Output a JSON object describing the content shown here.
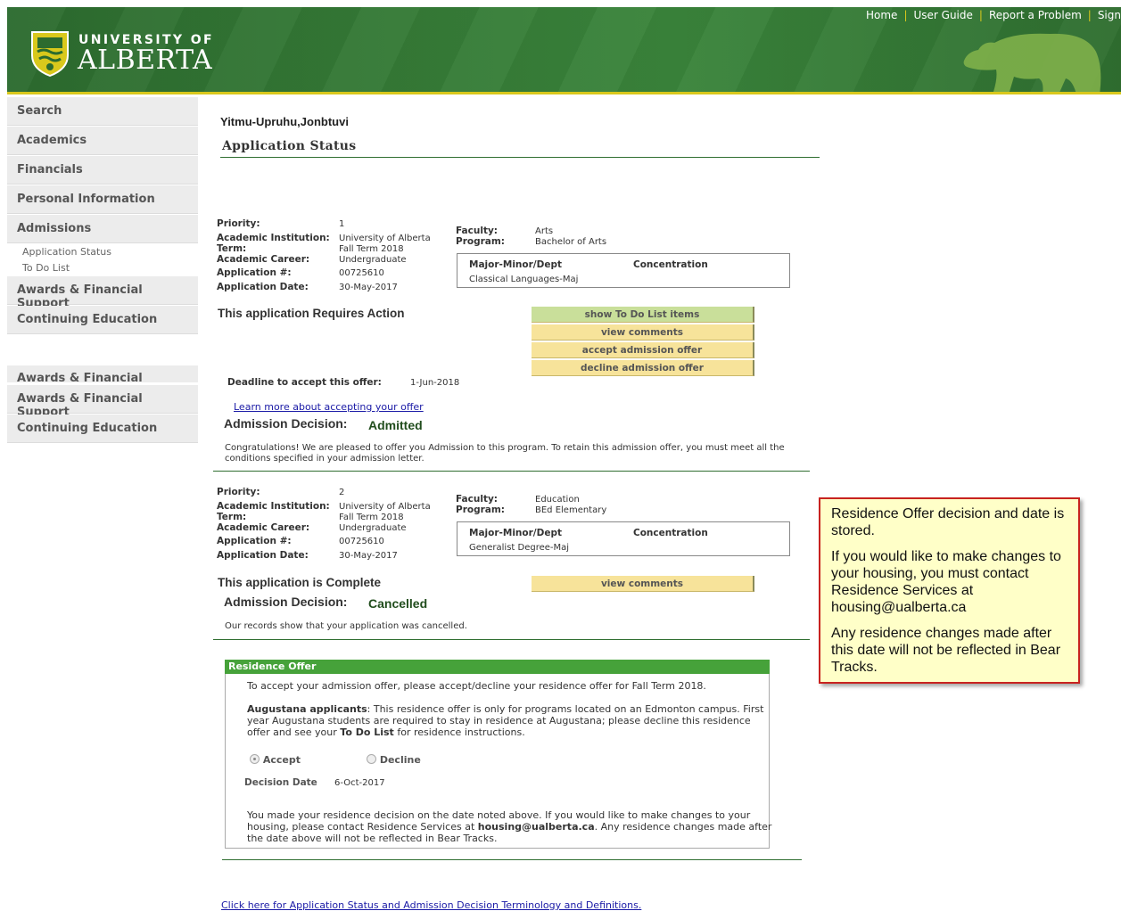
{
  "header": {
    "logo_top": "UNIVERSITY OF",
    "logo_main": "ALBERTA",
    "links": [
      "Home",
      "User Guide",
      "Report a Problem",
      "Sign"
    ],
    "colors": {
      "banner": "#357a36",
      "accent": "#d9c81c"
    }
  },
  "nav": {
    "items": [
      "Search",
      "Academics",
      "Financials",
      "Personal Information",
      "Admissions"
    ],
    "admissions_sub": [
      "Application Status",
      "To Do List"
    ],
    "items_after": [
      "Awards & Financial Support",
      "Continuing Education"
    ],
    "ghost_item": "Awards & Financial Support",
    "items_lower": [
      "Awards & Financial Support",
      "Continuing Education"
    ]
  },
  "student_name": "Yitmu-Upruhu,Jonbtuvi",
  "page_title": "Application Status",
  "labels": {
    "priority": "Priority:",
    "institution": "Academic Institution:",
    "term": "Term:",
    "career": "Academic Career:",
    "app_num": "Application #:",
    "app_date": "Application Date:",
    "faculty": "Faculty:",
    "program": "Program:",
    "major": "Major-Minor/Dept",
    "concentration": "Concentration",
    "admission_decision": "Admission Decision:"
  },
  "app1": {
    "priority": "1",
    "institution": "University of Alberta",
    "term": "Fall Term 2018",
    "career": "Undergraduate",
    "app_num": "00725610",
    "app_date": "30-May-2017",
    "faculty": "Arts",
    "program": "Bachelor of Arts",
    "major": "Classical Languages-Maj",
    "status": "This application Requires Action",
    "buttons": [
      "show To Do List items",
      "view comments",
      "accept admission offer",
      "decline admission offer"
    ],
    "deadline_label": "Deadline to accept this offer:",
    "deadline": "1-Jun-2018",
    "learn_link": "Learn more about accepting your offer",
    "decision": "Admitted",
    "message_1": "Congratulations!  We are pleased to offer you Admission to this program. To retain this admission offer, you must meet all the",
    "message_2": "conditions specified in your admission letter."
  },
  "app2": {
    "priority": "2",
    "institution": "University of Alberta",
    "term": "Fall Term 2018",
    "career": "Undergraduate",
    "app_num": "00725610",
    "app_date": "30-May-2017",
    "faculty": "Education",
    "program": "BEd Elementary",
    "major": "Generalist Degree-Maj",
    "status": "This application is Complete",
    "button": "view comments",
    "decision": "Cancelled",
    "message": "Our records show that your application was cancelled."
  },
  "residence": {
    "title": "Residence Offer",
    "intro": "To accept your admission offer, please accept/decline your residence offer for Fall Term 2018.",
    "aug_bold": "Augustana applicants",
    "aug_line1": ": This residence offer is only for programs located on an Edmonton campus. First",
    "aug_line2": "year Augustana students are required to stay in residence at Augustana; please decline this residence",
    "aug_line3_a": "offer and see your ",
    "aug_line3_b": "To Do List",
    "aug_line3_c": " for residence instructions.",
    "accept": "Accept",
    "decline": "Decline",
    "selected": "Accept",
    "decision_date_label": "Decision Date",
    "decision_date": "6-Oct-2017",
    "note_line1": "You made your residence decision on the date noted above. If you would like to make changes to your",
    "note_line2_a": "housing, please contact Residence Services at ",
    "note_line2_b": "housing@ualberta.ca",
    "note_line2_c": ". Any residence changes made after",
    "note_line3": "the date above will not be reflected in Bear Tracks."
  },
  "footer_link": "Click here for Application Status and Admission Decision Terminology and Definitions.",
  "callout": {
    "p1": "Residence Offer decision and date is stored.",
    "p2": "If you would like to make changes to your housing, you must contact Residence Services at housing@ualberta.ca",
    "p3": "Any residence changes made after this date will not be reflected in Bear Tracks."
  }
}
